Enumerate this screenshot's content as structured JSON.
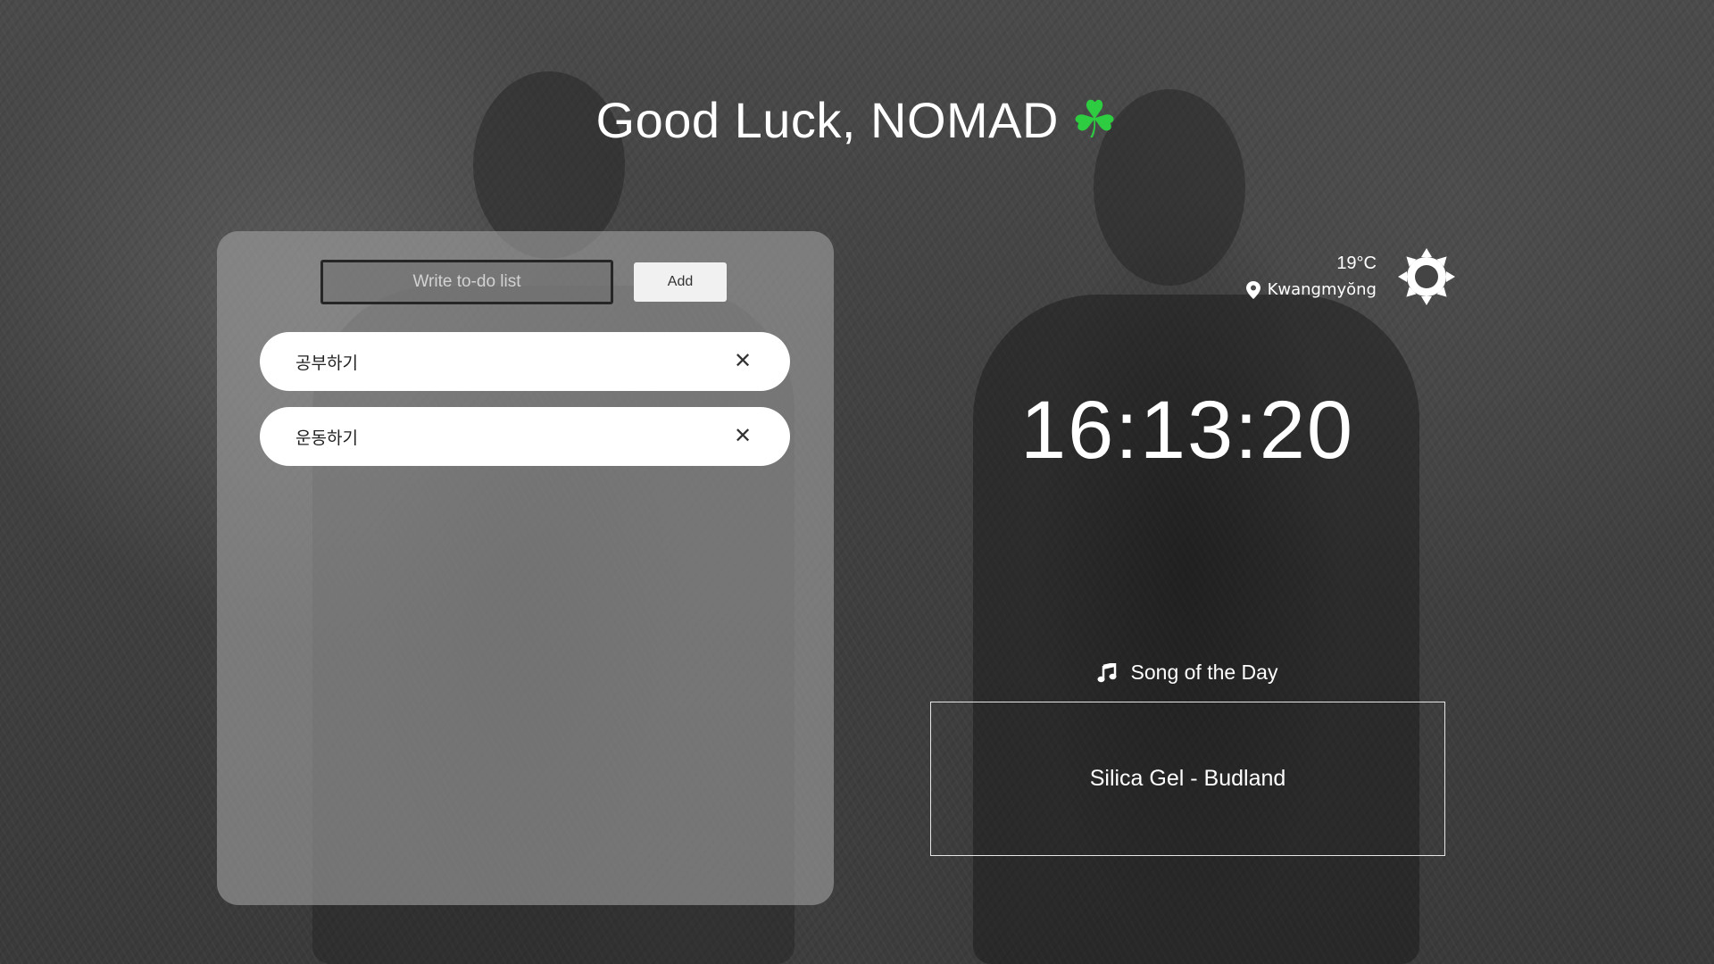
{
  "greeting": {
    "text": "Good Luck, NOMAD",
    "icon": "four-leaf-clover-icon",
    "icon_glyph": "☘",
    "icon_color": "#2ecc40"
  },
  "todo": {
    "input_placeholder": "Write to-do list",
    "input_value": "",
    "add_label": "Add",
    "items": [
      {
        "text": "공부하기",
        "delete_glyph": "✕"
      },
      {
        "text": "운동하기",
        "delete_glyph": "✕"
      }
    ]
  },
  "weather": {
    "temperature": "19°C",
    "location": "Kwangmyŏng",
    "location_icon": "map-pin-icon",
    "condition_icon": "sun-icon"
  },
  "clock": {
    "time": "16:13:20"
  },
  "song": {
    "header": "Song of the Day",
    "header_icon": "music-note-icon",
    "title": "Silica Gel - Budland"
  },
  "colors": {
    "panel_bg": "rgba(160,160,160,0.62)",
    "text_primary": "#ffffff",
    "item_bg": "#ffffff",
    "accent_clover": "#2ecc40"
  }
}
